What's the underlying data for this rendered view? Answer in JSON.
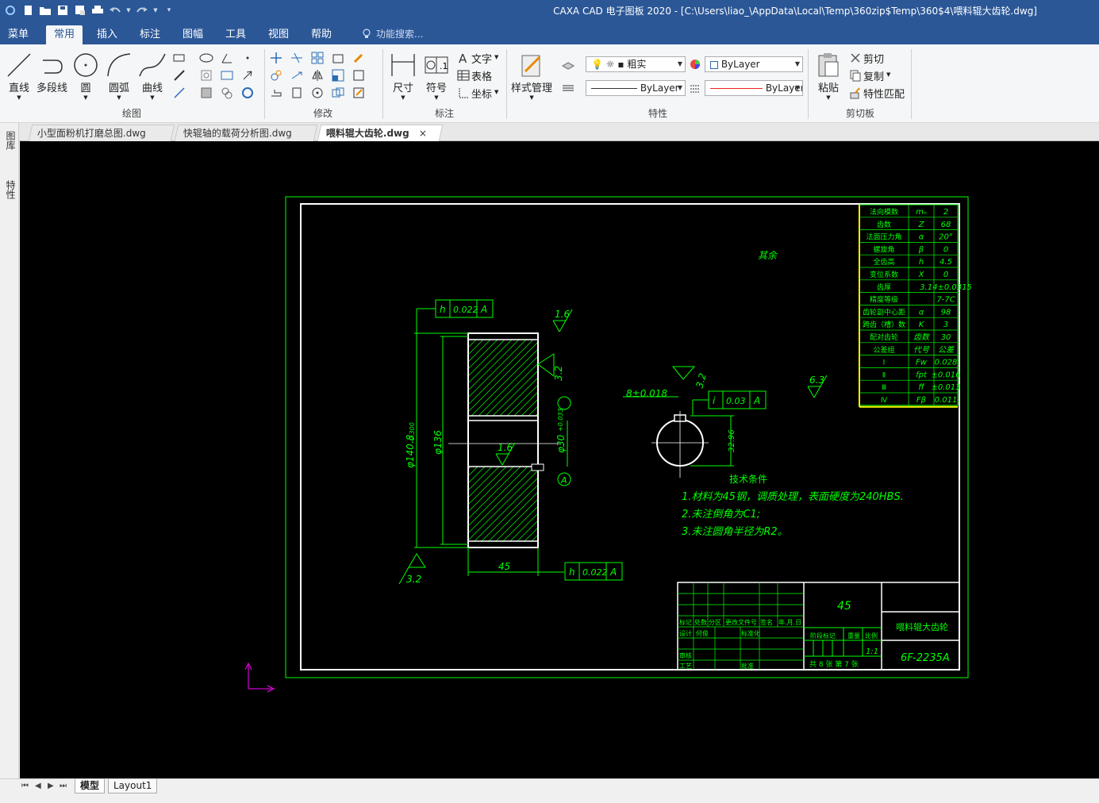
{
  "title": "CAXA CAD 电子图板 2020 - [C:\\Users\\liao_\\AppData\\Local\\Temp\\360zip$Temp\\360$4\\喂料辊大齿轮.dwg]",
  "menu": {
    "tabs": [
      "菜单",
      "常用",
      "插入",
      "标注",
      "图幅",
      "工具",
      "视图",
      "帮助"
    ],
    "active": "常用",
    "search_placeholder": "功能搜索..."
  },
  "ribbon": {
    "draw": {
      "title": "绘图",
      "buttons": [
        "直线",
        "多段线",
        "圆",
        "圆弧",
        "曲线"
      ]
    },
    "modify": {
      "title": "修改"
    },
    "annotate": {
      "title": "标注",
      "buttons": [
        "尺寸",
        "符号"
      ],
      "small": [
        "文字",
        "表格",
        "坐标"
      ]
    },
    "props": {
      "title": "特性",
      "style_btn": "样式管理",
      "layer_label": "粗实",
      "color": "ByLayer",
      "linetype": "ByLayer",
      "lineweight": "ByLayer"
    },
    "clipboard": {
      "title": "剪切板",
      "paste": "粘贴",
      "cut": "剪切",
      "copy": "复制",
      "match": "特性匹配"
    }
  },
  "doc_tabs": [
    {
      "name": "小型面粉机打磨总图.dwg",
      "active": false
    },
    {
      "name": "快辊轴的载荷分析图.dwg",
      "active": false
    },
    {
      "name": "喂料辊大齿轮.dwg",
      "active": true
    }
  ],
  "side_panel": [
    "图库",
    "特性"
  ],
  "layout_tabs": [
    {
      "name": "模型",
      "active": true
    },
    {
      "name": "Layout1",
      "active": false
    }
  ],
  "drawing": {
    "colors": {
      "frame": "#00ff00",
      "part": "#ffffff",
      "table": "#00ff00",
      "table_border": "#ffff00",
      "ucs": "#ff00ff"
    },
    "surface_note": "其余",
    "surface_value": "6.3",
    "tol_top": {
      "sym": "h",
      "val": "0.022",
      "ref": "A"
    },
    "tol_bottom": {
      "sym": "h",
      "val": "0.022",
      "ref": "A"
    },
    "tol_key": {
      "sym": "i",
      "val": "0.03",
      "ref": "A"
    },
    "rough_top": "1.6",
    "rough_side": "3.2",
    "rough_bottom": "3.2",
    "rough_mid": "1.6",
    "rough_key": "3.2",
    "dim_od": "φ140.8",
    "dim_od_tol": "-0.300",
    "dim_pitch": "φ136",
    "dim_bore": "φ30",
    "dim_bore_tol": "+0.033",
    "dim_width": "45",
    "dim_key": "8±0.018",
    "dim_key_depth": "32.96",
    "datum": "A",
    "tech_title": "技术条件",
    "tech_lines": [
      "1.材料为45钢，调质处理，表面硬度为240HBS.",
      "2.未注倒角为C1;",
      "3.未注圆角半径为R2。"
    ],
    "params": [
      [
        "法向模数",
        "mₙ",
        "2"
      ],
      [
        "齿数",
        "Z",
        "68"
      ],
      [
        "法面压力角",
        "α",
        "20°"
      ],
      [
        "螺旋角",
        "β",
        "0"
      ],
      [
        "全齿高",
        "h",
        "4.5"
      ],
      [
        "变位系数",
        "X",
        "0"
      ],
      [
        "齿厚",
        "",
        "3.14±0.0315"
      ],
      [
        "精度等级",
        "",
        "7-7C"
      ],
      [
        "齿轮副中心距",
        "α",
        "98"
      ],
      [
        "跨齿（槽）数",
        "K",
        "3"
      ],
      [
        "配对齿轮",
        "齿数",
        "30"
      ],
      [
        "公差组",
        "代号",
        "公差"
      ],
      [
        "Ⅰ",
        "Fw",
        "0.028"
      ],
      [
        "Ⅱ",
        "fpt",
        "±0.016"
      ],
      [
        "Ⅲ",
        "ff",
        "±0.013"
      ],
      [
        "Ⅳ",
        "Fβ",
        "0.011"
      ]
    ],
    "title_block": {
      "material": "45",
      "part_name": "喂料辊大齿轮",
      "drawing_no": "6F-2235A",
      "scale": "1:1",
      "sheets": "共 8 张 第 7 张",
      "row1": [
        "标记",
        "处数",
        "分区",
        "更改文件号",
        "签名",
        "年.月.日"
      ],
      "row2": [
        "设计",
        "何俊",
        "",
        "标准化"
      ],
      "row3": [
        "审核",
        "",
        "",
        ""
      ],
      "row4": [
        "工艺",
        "",
        "批准"
      ],
      "stage": [
        "阶段标记",
        "重量",
        "比例"
      ]
    }
  }
}
